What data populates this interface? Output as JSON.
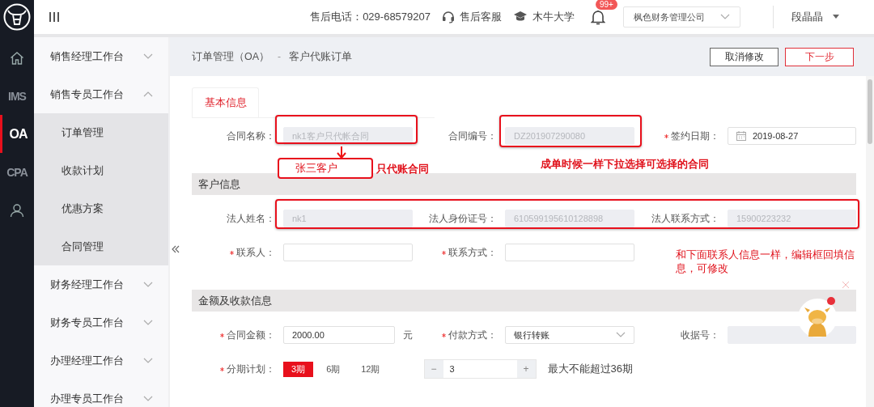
{
  "rail": {
    "items": [
      {
        "kind": "home",
        "selected": false
      },
      {
        "kind": "text",
        "label": "IMS",
        "selected": false
      },
      {
        "kind": "text",
        "label": "OA",
        "selected": true
      },
      {
        "kind": "text",
        "label": "CPA",
        "selected": false
      },
      {
        "kind": "user",
        "selected": false
      }
    ]
  },
  "topbar": {
    "phone": "售后电话：029-68579207",
    "service": "售后客服",
    "university": "木牛大学",
    "badge": "99+",
    "company": "枫色财务管理公司",
    "user": "段晶晶"
  },
  "sidebar": {
    "groups": [
      {
        "label": "销售经理工作台",
        "expanded": false
      },
      {
        "label": "销售专员工作台",
        "expanded": true,
        "children": [
          {
            "label": "订单管理"
          },
          {
            "label": "收款计划"
          },
          {
            "label": "优惠方案"
          },
          {
            "label": "合同管理"
          }
        ]
      },
      {
        "label": "财务经理工作台",
        "expanded": false
      },
      {
        "label": "财务专员工作台",
        "expanded": false
      },
      {
        "label": "办理经理工作台",
        "expanded": false
      },
      {
        "label": "办理专员工作台",
        "expanded": false
      }
    ]
  },
  "breadcrumb": {
    "parent": "订单管理（OA）",
    "separator": "-",
    "current": "客户代账订单"
  },
  "actions": [
    {
      "label": "取消修改",
      "kind": "default"
    },
    {
      "label": "下一步",
      "kind": "primary"
    }
  ],
  "form": {
    "tab": {
      "label": "基本信息",
      "selected": true
    },
    "sections": [
      {
        "rows": [
          [
            {
              "kind": "text",
              "label": "合同名称：",
              "required": false,
              "disabled": true,
              "value": "nk1客户只代帐合同"
            },
            {
              "kind": "text",
              "label": "合同编号：",
              "required": false,
              "disabled": true,
              "value": "DZ201907290080"
            },
            {
              "kind": "date",
              "label": "签约日期：",
              "required": true,
              "disabled": false,
              "value": "2019-08-27"
            }
          ]
        ]
      },
      {
        "title": "客户信息",
        "rows": [
          [
            {
              "kind": "text",
              "label": "法人姓名：",
              "required": false,
              "disabled": true,
              "value": "nk1"
            },
            {
              "kind": "text",
              "label": "法人身份证号：",
              "required": false,
              "disabled": true,
              "value": "610599195610128898"
            },
            {
              "kind": "text",
              "label": "法人联系方式：",
              "required": false,
              "disabled": true,
              "value": "15900223232"
            }
          ],
          [
            {
              "kind": "text",
              "label": "联系人：",
              "required": true,
              "disabled": false
            },
            {
              "kind": "text",
              "label": "联系方式：",
              "required": true,
              "disabled": false
            }
          ]
        ]
      },
      {
        "title": "金额及收款信息",
        "rows": [
          [
            {
              "kind": "amount",
              "label": "合同金额：",
              "required": true,
              "disabled": false,
              "value": "2000.00",
              "unit": "元"
            },
            {
              "kind": "select",
              "label": "付款方式：",
              "required": true,
              "disabled": false,
              "value": "银行转账"
            },
            {
              "kind": "text",
              "label": "收据号：",
              "required": false,
              "disabled": true
            }
          ],
          [
            {
              "kind": "installments",
              "label": "分期计划：",
              "required": true,
              "options": [
                {
                  "label": "3期",
                  "selected": true
                },
                {
                  "label": "6期",
                  "selected": false
                },
                {
                  "label": "12期",
                  "selected": false
                }
              ],
              "minus": "−",
              "value": "3",
              "plus": "+",
              "hint": "最大不能超过36期"
            }
          ]
        ]
      }
    ]
  },
  "annotations": [
    {
      "kind": "boxed",
      "text": "张三客户"
    },
    {
      "kind": "plain",
      "text": "只代账合同"
    },
    {
      "kind": "plain",
      "text": "成单时候一样下拉选择可选择的合同"
    },
    {
      "kind": "plain",
      "text": "和下面联系人信息一样，编辑框回填信息，可修改"
    }
  ]
}
